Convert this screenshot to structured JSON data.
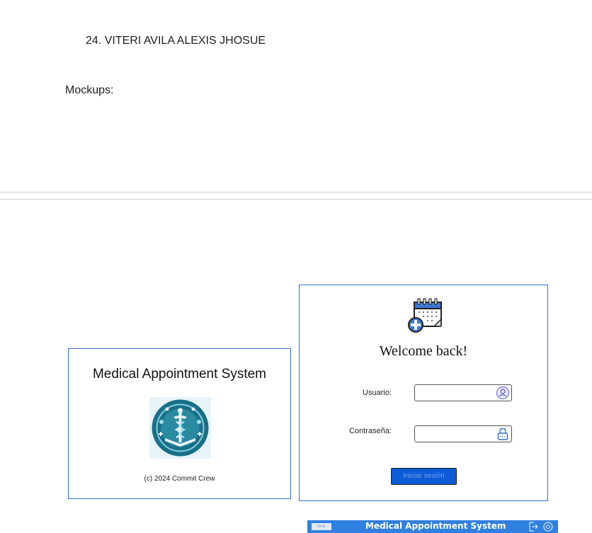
{
  "document": {
    "list_item": "24. VITERI AVILA ALEXIS JHOSUE",
    "section_label": "Mockups:"
  },
  "splash_mockup": {
    "title": "Medical Appointment System",
    "logo": "medical-caduceus-book-logo",
    "footer": "(c) 2024 Commit Crew"
  },
  "login_mockup": {
    "icon": "calendar-medical-plus-icon",
    "heading": "Welcome back!",
    "username_label": "Usuario:",
    "username_value": "",
    "username_icon": "user-circle-icon",
    "password_label": "Contraseña:",
    "password_value": "",
    "password_icon": "lock-icon",
    "submit_label": "Iniciar sesión"
  },
  "app_bar_mockup": {
    "tab_label": "inicio",
    "title": "Medical Appointment System",
    "icons": [
      "logout-icon",
      "help-icon"
    ]
  },
  "colors": {
    "frame_border": "#2f6fd6",
    "button_fill": "#0d5bd7",
    "app_bar": "#2f80e0",
    "logo_teal": "#1a6f86"
  }
}
